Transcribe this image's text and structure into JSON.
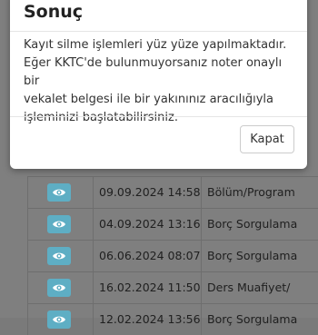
{
  "modal": {
    "title": "Sonuç",
    "message_lines": [
      "Kayıt silme işlemleri yüz yüze yapılmaktadır.",
      "Eğer KKTC'de bulunmuyorsanız noter onaylı bir",
      "vekalet belgesi ile bir yakınınız aracılığıyla",
      "işleminizi başlatabilirsiniz."
    ],
    "close_label": "Kapat"
  },
  "table": {
    "rows": [
      {
        "icon": "eye-icon",
        "date": "09.09.2024 14:58",
        "type": "Bölüm/Program"
      },
      {
        "icon": "eye-icon",
        "date": "04.09.2024 13:16",
        "type": "Borç Sorgulama"
      },
      {
        "icon": "eye-icon",
        "date": "06.06.2024 08:07",
        "type": "Borç Sorgulama"
      },
      {
        "icon": "eye-icon",
        "date": "16.02.2024 11:50",
        "type": "Ders Muafiyet/"
      },
      {
        "icon": "eye-icon",
        "date": "12.02.2024 13:56",
        "type": "Borç Sorgulama"
      }
    ]
  },
  "colors": {
    "overlay_background": "#7f7f7f",
    "view_button": "#5eaec4",
    "modal_background": "#ffffff"
  }
}
